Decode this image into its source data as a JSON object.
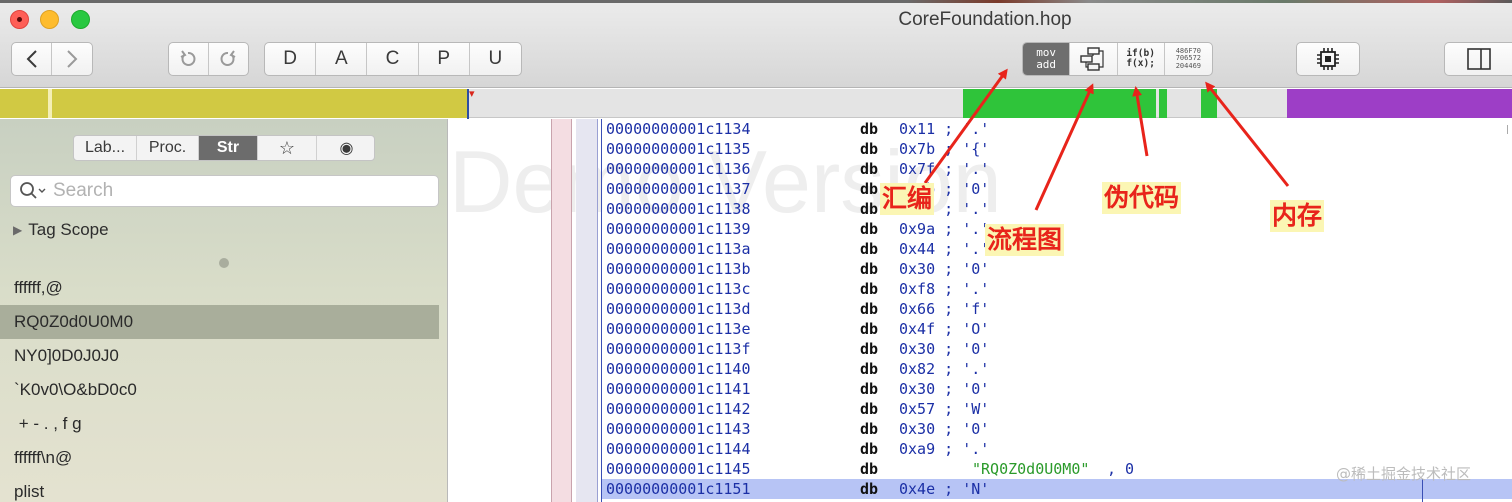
{
  "window": {
    "title": "CoreFoundation.hop"
  },
  "toolbar": {
    "back_icon": "chevron-left-icon",
    "forward_icon": "chevron-right-icon",
    "undo_icon": "undo-icon",
    "redo_icon": "redo-icon",
    "modes": [
      "D",
      "A",
      "C",
      "P",
      "U"
    ],
    "view_asm_line1": "mov",
    "view_asm_line2": "add",
    "view_cfg_icon": "flowchart-icon",
    "view_pseudo_line1": "if(b)",
    "view_pseudo_line2": "f(x);",
    "view_hex_line1": "486F70",
    "view_hex_line2": "706572",
    "view_hex_line3": "204469",
    "cpu_icon": "cpu-chip-icon",
    "panel_icon": "sidebar-panel-icon"
  },
  "segment_bar": {
    "colors": {
      "code": "#d1c943",
      "data": "#e4e4e4",
      "green": "#2fc43a",
      "purple": "#9d3ec6",
      "cursor": "#2d4ea3"
    }
  },
  "sidebar": {
    "tabs": [
      "Lab...",
      "Proc.",
      "Str"
    ],
    "star_icon": "star-icon",
    "tag_icon": "target-icon",
    "search": {
      "placeholder": "Search",
      "value": ""
    },
    "tag_scope": "Tag Scope",
    "strings": [
      "ffffff,@",
      "RQ0Z0d0U0M0",
      "NY0]0D0J0J0",
      "`K0v0\\O&bD0c0",
      " + - . , f g",
      "ffffff\\n@",
      "plist"
    ],
    "selected_index": 1
  },
  "code": {
    "watermark": "Demo Version",
    "lines": [
      {
        "addr": "00000000001c1134",
        "mnem": "db",
        "op": "0x11 ; '.'"
      },
      {
        "addr": "00000000001c1135",
        "mnem": "db",
        "op": "0x7b ; '{'"
      },
      {
        "addr": "00000000001c1136",
        "mnem": "db",
        "op": "0x7f ; '.'"
      },
      {
        "addr": "00000000001c1137",
        "mnem": "db",
        "op": "0x1b ; '0'"
      },
      {
        "addr": "00000000001c1138",
        "mnem": "db",
        "op": "0x1c ; '.'"
      },
      {
        "addr": "00000000001c1139",
        "mnem": "db",
        "op": "0x9a ; '.'"
      },
      {
        "addr": "00000000001c113a",
        "mnem": "db",
        "op": "0x44 ; '.'"
      },
      {
        "addr": "00000000001c113b",
        "mnem": "db",
        "op": "0x30 ; '0'"
      },
      {
        "addr": "00000000001c113c",
        "mnem": "db",
        "op": "0xf8 ; '.'"
      },
      {
        "addr": "00000000001c113d",
        "mnem": "db",
        "op": "0x66 ; 'f'"
      },
      {
        "addr": "00000000001c113e",
        "mnem": "db",
        "op": "0x4f ; 'O'"
      },
      {
        "addr": "00000000001c113f",
        "mnem": "db",
        "op": "0x30 ; '0'"
      },
      {
        "addr": "00000000001c1140",
        "mnem": "db",
        "op": "0x82 ; '.'"
      },
      {
        "addr": "00000000001c1141",
        "mnem": "db",
        "op": "0x30 ; '0'"
      },
      {
        "addr": "00000000001c1142",
        "mnem": "db",
        "op": "0x57 ; 'W'"
      },
      {
        "addr": "00000000001c1143",
        "mnem": "db",
        "op": "0x30 ; '0'"
      },
      {
        "addr": "00000000001c1144",
        "mnem": "db",
        "op": "0xa9 ; '.'"
      },
      {
        "addr": "00000000001c1145",
        "mnem": "db",
        "op": "",
        "str": "\"RQ0Z0d0U0M0\"",
        "tail": ", 0"
      },
      {
        "addr": "00000000001c1151",
        "mnem": "db",
        "op": "0x4e ; 'N'"
      }
    ],
    "selected_index": 18
  },
  "annotations": {
    "assembly": "汇编",
    "flowchart": "流程图",
    "pseudocode": "伪代码",
    "memory": "内存",
    "arrow_color": "#e8241b"
  },
  "site_watermark": "@稀土掘金技术社区"
}
